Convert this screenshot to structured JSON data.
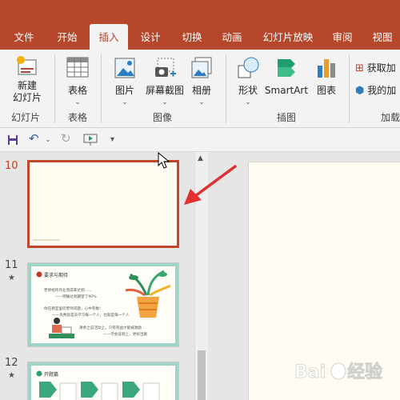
{
  "tabs": [
    {
      "label": "文件"
    },
    {
      "label": "开始"
    },
    {
      "label": "插入"
    },
    {
      "label": "设计"
    },
    {
      "label": "切换"
    },
    {
      "label": "动画"
    },
    {
      "label": "幻灯片放映"
    },
    {
      "label": "审阅"
    },
    {
      "label": "视图"
    }
  ],
  "ribbon": {
    "new_slide_line1": "新建",
    "new_slide_line2": "幻灯片",
    "group_slides": "幻灯片",
    "table": "表格",
    "group_tables": "表格",
    "picture": "图片",
    "screenshot": "屏幕截图",
    "album": "相册",
    "group_images": "图像",
    "shapes": "形状",
    "smartart": "SmartArt",
    "chart": "图表",
    "group_illustrations": "插图",
    "get_addins": "获取加",
    "my_addins": "我的加",
    "group_addins": "加载"
  },
  "slides": {
    "s10_number": "10",
    "s11_number": "11",
    "s12_number": "12",
    "star": "★",
    "s11_title": "要求与期待",
    "s11_line1": "老师给的作业完成率达到……",
    "s11_line2": "——明确达到期望了90%",
    "s11_line3": "你在教室里问老师问题，心中有数！",
    "s11_line4": "——优秀就是去学习每一个人，也就是每一个人",
    "s11_line5": "课余之说活动上，只有有益才能被激励",
    "s11_line6": "——学会读到上，更好出路",
    "s12_title": "开题篇"
  },
  "colors": {
    "accent": "#b7472a",
    "selected_border": "#c0472d",
    "arrow": "#e03030",
    "slide_frame_green": "#9fd4c8"
  }
}
